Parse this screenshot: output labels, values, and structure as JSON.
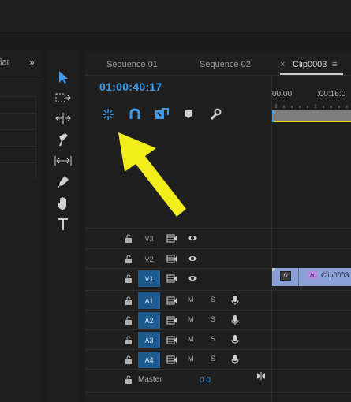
{
  "left_panel": {
    "tab_label": "lar",
    "chevron": "»"
  },
  "tools": [
    {
      "name": "selection-tool-icon",
      "active": true
    },
    {
      "name": "track-select-tool-icon"
    },
    {
      "name": "ripple-edit-tool-icon"
    },
    {
      "name": "razor-tool-icon"
    },
    {
      "name": "slip-tool-icon"
    },
    {
      "name": "pen-tool-icon"
    },
    {
      "name": "hand-tool-icon"
    },
    {
      "name": "type-tool-icon"
    }
  ],
  "timeline": {
    "tabs": [
      "Sequence 01",
      "Sequence 02",
      "Clip0003"
    ],
    "close_glyph": "×",
    "menu_glyph": "≡",
    "timecode": "01:00:40:17",
    "ruler": [
      "00:00",
      ":00:16:0"
    ],
    "controls": [
      "nest-icon",
      "snap-icon",
      "linked-selection-icon",
      "add-marker-icon",
      "timeline-settings-icon"
    ]
  },
  "tracks": {
    "video": [
      {
        "name": "V3",
        "target": false
      },
      {
        "name": "V2",
        "target": false
      },
      {
        "name": "V1",
        "target": true
      }
    ],
    "audio": [
      {
        "name": "A1",
        "target": true,
        "mute": "M",
        "solo": "S"
      },
      {
        "name": "A2",
        "target": true,
        "mute": "M",
        "solo": "S"
      },
      {
        "name": "A3",
        "target": true,
        "mute": "M",
        "solo": "S"
      },
      {
        "name": "A4",
        "target": true,
        "mute": "M",
        "solo": "S"
      }
    ],
    "master": {
      "label": "Master",
      "value": "0.0"
    }
  },
  "clip": {
    "name": "Clip0003.",
    "fx_label": "fx"
  },
  "colors": {
    "accent": "#3c9bea",
    "arrow": "#f2ee1c",
    "clip": "#8aa0d6",
    "target": "#1d5a8e"
  }
}
